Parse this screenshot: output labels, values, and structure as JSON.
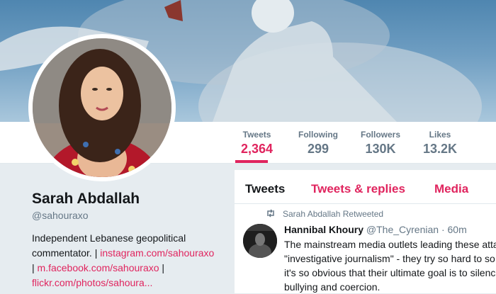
{
  "profile": {
    "name": "Sarah Abdallah",
    "handle": "@sahouraxo",
    "bio_text": "Independent Lebanese geopolitical commentator. | ",
    "bio_link1": "instagram.com/sahouraxo",
    "bio_sep1": "| ",
    "bio_link2": "m.facebook.com/sahouraxo",
    "bio_sep2": " |",
    "bio_link3": "flickr.com/photos/sahoura..."
  },
  "stats": {
    "tweets_label": "Tweets",
    "tweets_value": "2,364",
    "following_label": "Following",
    "following_value": "299",
    "followers_label": "Followers",
    "followers_value": "130K",
    "likes_label": "Likes",
    "likes_value": "13.2K"
  },
  "tabs": {
    "tweets": "Tweets",
    "replies": "Tweets & replies",
    "media": "Media"
  },
  "tweet": {
    "retweet_notice": "Sarah Abdallah Retweeted",
    "author_name": "Hannibal Khoury",
    "author_handle": "@The_Cyrenian",
    "time": "· 60m",
    "lines": [
      "The mainstream media outlets leading these atta",
      "\"investigative journalism\" - they try so hard to so",
      "it's so obvious that their ultimate goal is to silenc",
      "bullying and coercion."
    ]
  },
  "colors": {
    "accent": "#e0245e",
    "text": "#14171a",
    "muted": "#657786",
    "page_bg": "#e6ecf0"
  },
  "icons": {
    "retweet": "retweet-icon"
  }
}
